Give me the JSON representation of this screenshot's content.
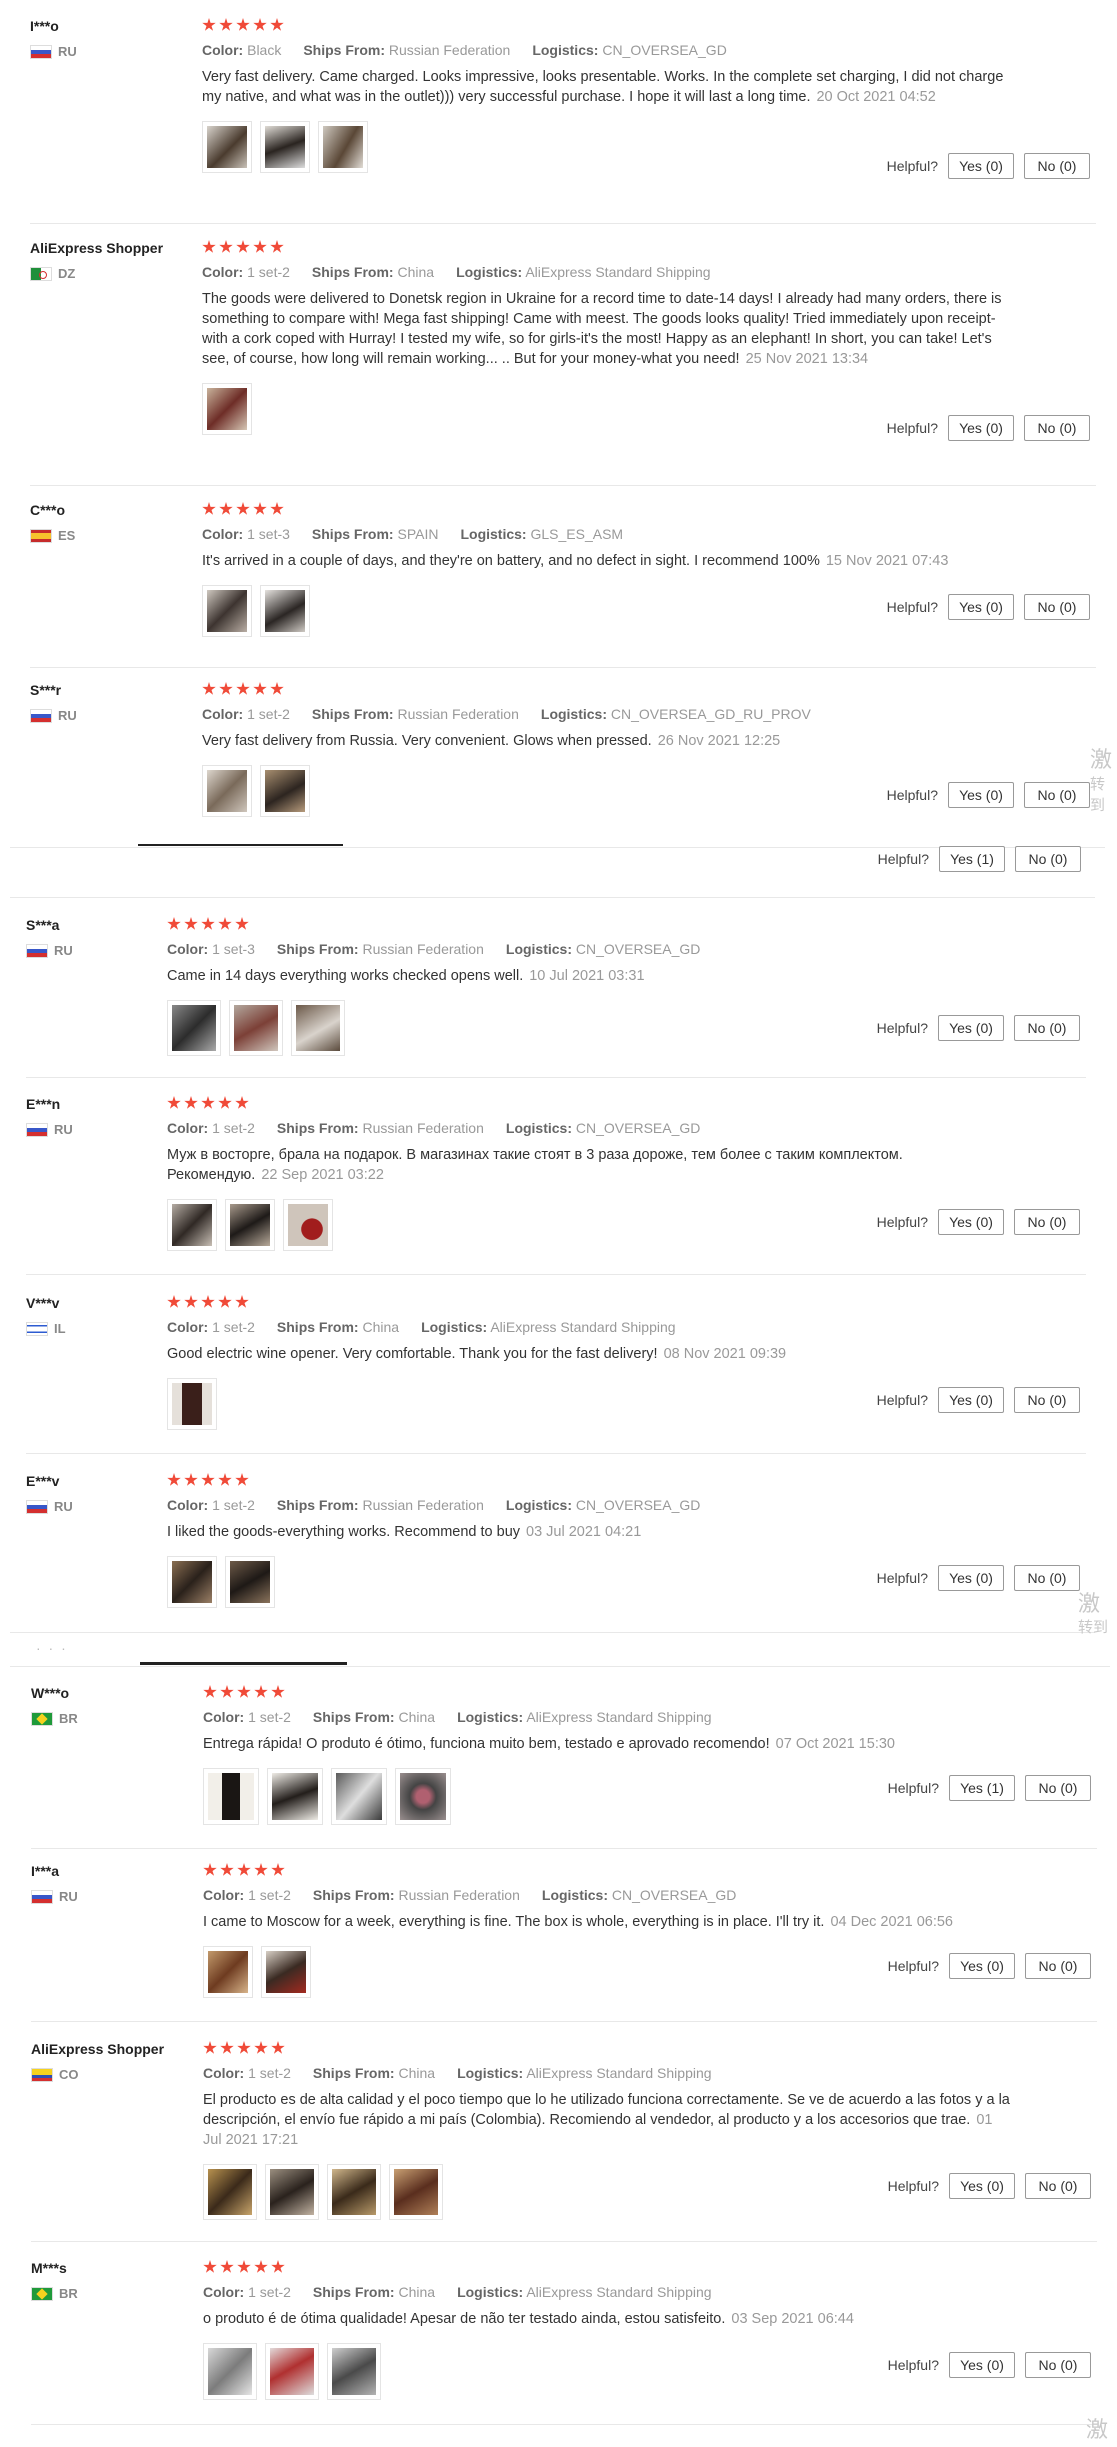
{
  "labels": {
    "color": "Color:",
    "ships_from": "Ships From:",
    "logistics": "Logistics:",
    "helpful": "Helpful?"
  },
  "colors": {
    "star": "#f04a38",
    "accent": "#f04a38"
  },
  "reviews": [
    {
      "user": "I***o",
      "country": "RU",
      "color": "Black",
      "ships": "Russian Federation",
      "logistics": "CN_OVERSEA_GD",
      "text": "Very fast delivery. Came charged. Looks impressive, looks presentable. Works. In the complete set charging, I did not charge my native, and what was in the outlet))) very successful purchase. I hope it will last a long time.",
      "date": "20 Oct 2021 04:52",
      "yes": "Yes (0)",
      "no": "No (0)",
      "images": 3
    },
    {
      "user": "AliExpress Shopper",
      "country": "DZ",
      "color": "1 set-2",
      "ships": "China",
      "logistics": "AliExpress Standard Shipping",
      "text": "The goods were delivered to Donetsk region in Ukraine for a record time to date-14 days! I already had many orders, there is something to compare with! Mega fast shipping! Came with meest. The goods looks quality! Tried immediately upon receipt-with a cork coped with Hurray! I tested my wife, so for girls-it's the most! Happy as an elephant! In short, you can take! Let's see, of course, how long will remain working... .. But for your money-what you need!",
      "date": "25 Nov 2021 13:34",
      "yes": "Yes (0)",
      "no": "No (0)",
      "images": 1
    },
    {
      "user": "C***o",
      "country": "ES",
      "color": "1 set-3",
      "ships": "SPAIN",
      "logistics": "GLS_ES_ASM",
      "text": "It's arrived in a couple of days, and they're on battery, and no defect in sight. I recommend 100%",
      "date": "15 Nov 2021 07:43",
      "yes": "Yes (0)",
      "no": "No (0)",
      "images": 2
    },
    {
      "user": "S***r",
      "country": "RU",
      "color": "1 set-2",
      "ships": "Russian Federation",
      "logistics": "CN_OVERSEA_GD_RU_PROV",
      "text": "Very fast delivery from Russia. Very convenient. Glows when pressed.",
      "date": "26 Nov 2021 12:25",
      "yes": "Yes (0)",
      "no": "No (0)",
      "images": 2
    },
    {
      "user": "S***a",
      "country": "RU",
      "color": "1 set-3",
      "ships": "Russian Federation",
      "logistics": "CN_OVERSEA_GD",
      "text": "Came in 14 days everything works checked opens well.",
      "date": "10 Jul 2021 03:31",
      "yes": "Yes (0)",
      "no": "No (0)",
      "images": 3
    },
    {
      "user": "E***n",
      "country": "RU",
      "color": "1 set-2",
      "ships": "Russian Federation",
      "logistics": "CN_OVERSEA_GD",
      "text": "Муж в восторге, брала на подарок. В магазинах такие стоят в 3 раза дороже, тем более с таким комплектом. Рекомендую.",
      "date": "22 Sep 2021 03:22",
      "yes": "Yes (0)",
      "no": "No (0)",
      "images": 3
    },
    {
      "user": "V***v",
      "country": "IL",
      "color": "1 set-2",
      "ships": "China",
      "logistics": "AliExpress Standard Shipping",
      "text": "Good electric wine opener. Very comfortable. Thank you for the fast delivery!",
      "date": "08 Nov 2021 09:39",
      "yes": "Yes (0)",
      "no": "No (0)",
      "images": 1
    },
    {
      "user": "E***v",
      "country": "RU",
      "color": "1 set-2",
      "ships": "Russian Federation",
      "logistics": "CN_OVERSEA_GD",
      "text": "I liked the goods-everything works. Recommend to buy",
      "date": "03 Jul 2021 04:21",
      "yes": "Yes (0)",
      "no": "No (0)",
      "images": 2
    },
    {
      "user": "W***o",
      "country": "BR",
      "color": "1 set-2",
      "ships": "China",
      "logistics": "AliExpress Standard Shipping",
      "text": "Entrega rápida! O produto é ótimo, funciona muito bem, testado e aprovado recomendo!",
      "date": "07 Oct 2021 15:30",
      "yes": "Yes (1)",
      "no": "No (0)",
      "images": 4
    },
    {
      "user": "I***a",
      "country": "RU",
      "color": "1 set-2",
      "ships": "Russian Federation",
      "logistics": "CN_OVERSEA_GD",
      "text": "I came to Moscow for a week, everything is fine. The box is whole, everything is in place. I'll try it.",
      "date": "04 Dec 2021 06:56",
      "yes": "Yes (0)",
      "no": "No (0)",
      "images": 2
    },
    {
      "user": "AliExpress Shopper",
      "country": "CO",
      "color": "1 set-2",
      "ships": "China",
      "logistics": "AliExpress Standard Shipping",
      "text": "El producto es de alta calidad y el poco tiempo que lo he utilizado funciona correctamente. Se ve de acuerdo a las fotos y a la descripción, el envío fue rápido a mi país (Colombia). Recomiendo al vendedor, al producto y a los accesorios que trae.",
      "date": "01 Jul 2021 17:21",
      "yes": "Yes (0)",
      "no": "No (0)",
      "images": 4
    },
    {
      "user": "M***s",
      "country": "BR",
      "color": "1 set-2",
      "ships": "China",
      "logistics": "AliExpress Standard Shipping",
      "text": "o produto é de ótima qualidade! Apesar de não ter testado ainda, estou satisfeito.",
      "date": "03 Sep 2021 06:44",
      "yes": "Yes (0)",
      "no": "No (0)",
      "images": 3
    }
  ],
  "extra_helpful": {
    "label": "Helpful?",
    "yes": "Yes (1)",
    "no": "No (0)"
  },
  "watermark": {
    "char": "激",
    "sub": "转到"
  }
}
